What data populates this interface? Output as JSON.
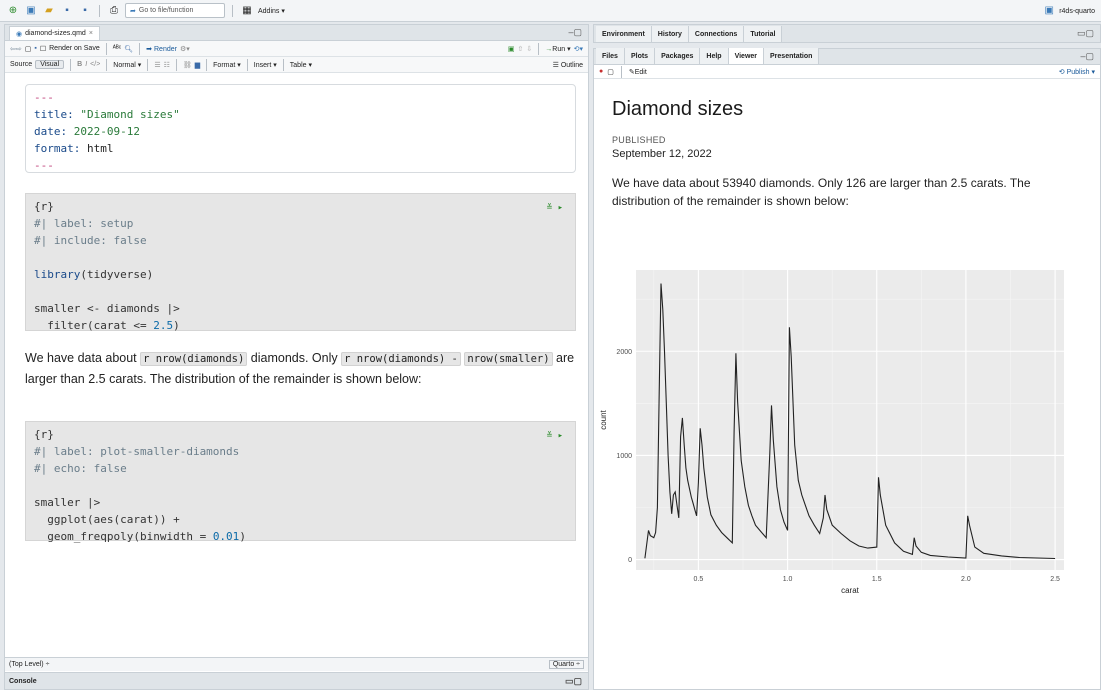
{
  "toolbar": {
    "goto_placeholder": "Go to file/function",
    "addins": "Addins",
    "project": "r4ds-quarto"
  },
  "editor": {
    "file_tab": "diamond-sizes.qmd",
    "render_on_save": "Render on Save",
    "render": "Render",
    "run": "Run",
    "source": "Source",
    "visual": "Visual",
    "normal": "Normal",
    "format": "Format",
    "insert": "Insert",
    "table": "Table",
    "outline": "Outline",
    "yaml": {
      "dash": "---",
      "title_key": "title:",
      "title_val": "\"Diamond sizes\"",
      "date_key": "date:",
      "date_val": "2022-09-12",
      "format_key": "format:",
      "format_val": "html"
    },
    "chunk1": {
      "header": "{r}",
      "opt1": "#| label: setup",
      "opt2": "#| include: false",
      "lib_fn": "library",
      "lib_arg": "(tidyverse)",
      "l5": "smaller <- diamonds |>",
      "l6a": "  filter(carat <= ",
      "l6n": "2.5",
      "l6b": ")"
    },
    "prose": {
      "p1": "We have data about ",
      "c1": "r nrow(diamonds)",
      "p2": " diamonds. Only ",
      "c2": "r nrow(diamonds) -",
      "c3": "nrow(smaller)",
      "p3": " are larger than 2.5 carats. The distribution of the remainder is shown below:"
    },
    "chunk2": {
      "header": "{r}",
      "opt1": "#| label: plot-smaller-diamonds",
      "opt2": "#| echo: false",
      "l4": "smaller |>",
      "l5": "  ggplot(aes(carat)) +",
      "l6a": "  geom_freqpoly(binwidth = ",
      "l6n": "0.01",
      "l6b": ")"
    },
    "status_left": "(Top Level) ÷",
    "status_right": "Quarto ÷",
    "console": "Console"
  },
  "right_top_tabs": [
    "Environment",
    "History",
    "Connections",
    "Tutorial"
  ],
  "right_tabs": [
    "Files",
    "Plots",
    "Packages",
    "Help",
    "Viewer",
    "Presentation"
  ],
  "viewer": {
    "edit": "Edit",
    "publish": "Publish",
    "title": "Diamond sizes",
    "published_label": "PUBLISHED",
    "date": "September 12, 2022",
    "body": "We have data about 53940 diamonds. Only 126 are larger than 2.5 carats. The distribution of the remainder is shown below:"
  },
  "chart_data": {
    "type": "line",
    "xlabel": "carat",
    "ylabel": "count",
    "xlim": [
      0.15,
      2.55
    ],
    "ylim": [
      -100,
      2780
    ],
    "xticks": [
      0.5,
      1.0,
      1.5,
      2.0,
      2.5
    ],
    "xtick_labels": [
      "0.5",
      "1.0",
      "1.5",
      "2.0",
      "2.5"
    ],
    "yticks": [
      0,
      1000,
      2000
    ],
    "ytick_labels": [
      "0",
      "1000",
      "2000"
    ],
    "grid": true,
    "x": [
      0.2,
      0.22,
      0.23,
      0.25,
      0.26,
      0.27,
      0.28,
      0.29,
      0.3,
      0.31,
      0.32,
      0.33,
      0.34,
      0.35,
      0.36,
      0.37,
      0.38,
      0.39,
      0.4,
      0.41,
      0.42,
      0.43,
      0.44,
      0.45,
      0.46,
      0.47,
      0.48,
      0.49,
      0.5,
      0.51,
      0.52,
      0.53,
      0.55,
      0.57,
      0.6,
      0.63,
      0.66,
      0.69,
      0.7,
      0.71,
      0.72,
      0.74,
      0.76,
      0.78,
      0.8,
      0.82,
      0.85,
      0.88,
      0.9,
      0.91,
      0.92,
      0.94,
      0.96,
      0.98,
      1.0,
      1.01,
      1.02,
      1.04,
      1.06,
      1.08,
      1.1,
      1.12,
      1.15,
      1.18,
      1.2,
      1.21,
      1.22,
      1.25,
      1.3,
      1.35,
      1.4,
      1.45,
      1.5,
      1.51,
      1.52,
      1.55,
      1.6,
      1.65,
      1.7,
      1.71,
      1.72,
      1.75,
      1.8,
      1.9,
      2.0,
      2.01,
      2.02,
      2.05,
      2.1,
      2.2,
      2.3,
      2.4,
      2.5
    ],
    "y": [
      12,
      280,
      230,
      210,
      260,
      500,
      1600,
      2650,
      2400,
      2000,
      1500,
      1000,
      650,
      440,
      620,
      650,
      520,
      400,
      1180,
      1360,
      1100,
      880,
      760,
      680,
      600,
      540,
      480,
      420,
      740,
      1260,
      1100,
      880,
      600,
      430,
      330,
      260,
      210,
      160,
      1230,
      1980,
      1520,
      950,
      700,
      520,
      420,
      330,
      270,
      210,
      1020,
      1480,
      1150,
      700,
      480,
      360,
      280,
      2230,
      1950,
      1100,
      760,
      620,
      520,
      420,
      330,
      250,
      400,
      620,
      480,
      330,
      250,
      180,
      130,
      110,
      120,
      790,
      620,
      330,
      160,
      80,
      50,
      210,
      130,
      70,
      40,
      25,
      15,
      420,
      330,
      120,
      60,
      35,
      20,
      15,
      10
    ]
  }
}
